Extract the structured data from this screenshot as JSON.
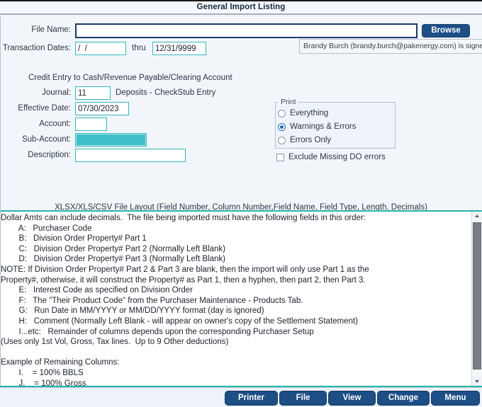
{
  "window": {
    "title": "General Import Listing"
  },
  "form": {
    "file_name_label": "File Name:",
    "file_name_value": "",
    "file_name_placeholder": "",
    "browse_label": "Browse",
    "transaction_dates_label": "Transaction Dates:",
    "transaction_date_from": "/  /",
    "thru_label": "thru",
    "transaction_date_to": "12/31/9999",
    "credit_entry_heading": "Credit Entry to Cash/Revenue Payable/Clearing Account",
    "journal_label": "Journal:",
    "journal_value": "11",
    "journal_description": "Deposits - CheckStub Entry",
    "effective_date_label": "Effective Date:",
    "effective_date_value": "07/30/2023",
    "account_label": "Account:",
    "account_value": "",
    "sub_account_label": "Sub-Account:",
    "sub_account_value": "",
    "description_label": "Description:",
    "description_value": ""
  },
  "tooltip": {
    "text": "Brandy Burch (brandy.burch@pakenergy.com) is signed"
  },
  "print_group": {
    "legend": "Print",
    "options": [
      {
        "label": "Everything",
        "selected": false
      },
      {
        "label": "Warnings & Errors",
        "selected": true
      },
      {
        "label": "Errors Only",
        "selected": false
      }
    ],
    "exclude_checkbox": {
      "label": "Exclude Missing DO errors",
      "checked": false
    }
  },
  "layout_section": {
    "caption": "XLSX/XLS/CSV File Layout (Field Number, Column Number,Field Name, Field Type, Length, Decimals)",
    "lines": [
      "Dollar Amts can include decimals.  The file being imported must have the following fields in this order:",
      "        A:   Purchaser Code",
      "        B:   Division Order Property# Part 1",
      "        C:   Division Order Property# Part 2 (Normally Left Blank)",
      "        D:   Division Order Property# Part 3 (Normally Left Blank)",
      "NOTE: If Division Order Property# Part 2 & Part 3 are blank, then the import will only use Part 1 as the",
      "Property#, otherwise, it will construct the Property# as Part 1, then a hyphen, then part 2, then Part 3.",
      "        E:   Interest Code as specified on Division Order",
      "        F:   The \"Their Product Code\" from the Purchaser Maintenance - Products Tab.",
      "        G:   Run Date in MM/YYYY or MM/DD/YYYY format (day is ignored)",
      "        H:   Comment (Normally Left Blank - will appear on owner's copy of the Settlement Statement)",
      "        I...etc:   Remainder of columns depends upon the corresponding Purchaser Setup",
      "(Uses only 1st Vol, Gross, Tax lines.  Up to 9 Other deductions)",
      "",
      "Example of Remaining Columns:",
      "        I.    = 100% BBLS",
      "        J.    = 100% Gross"
    ]
  },
  "toolbar": {
    "buttons": [
      {
        "label": "Printer"
      },
      {
        "label": "File"
      },
      {
        "label": "View"
      },
      {
        "label": "Change"
      },
      {
        "label": "Menu"
      }
    ]
  },
  "colors": {
    "accent_blue": "#1d4f86",
    "field_border_teal": "#2fb8bf",
    "highlight_teal": "#3fc0c8",
    "rule_teal": "#21b6a8",
    "panel_bg": "#f2f6fb"
  }
}
